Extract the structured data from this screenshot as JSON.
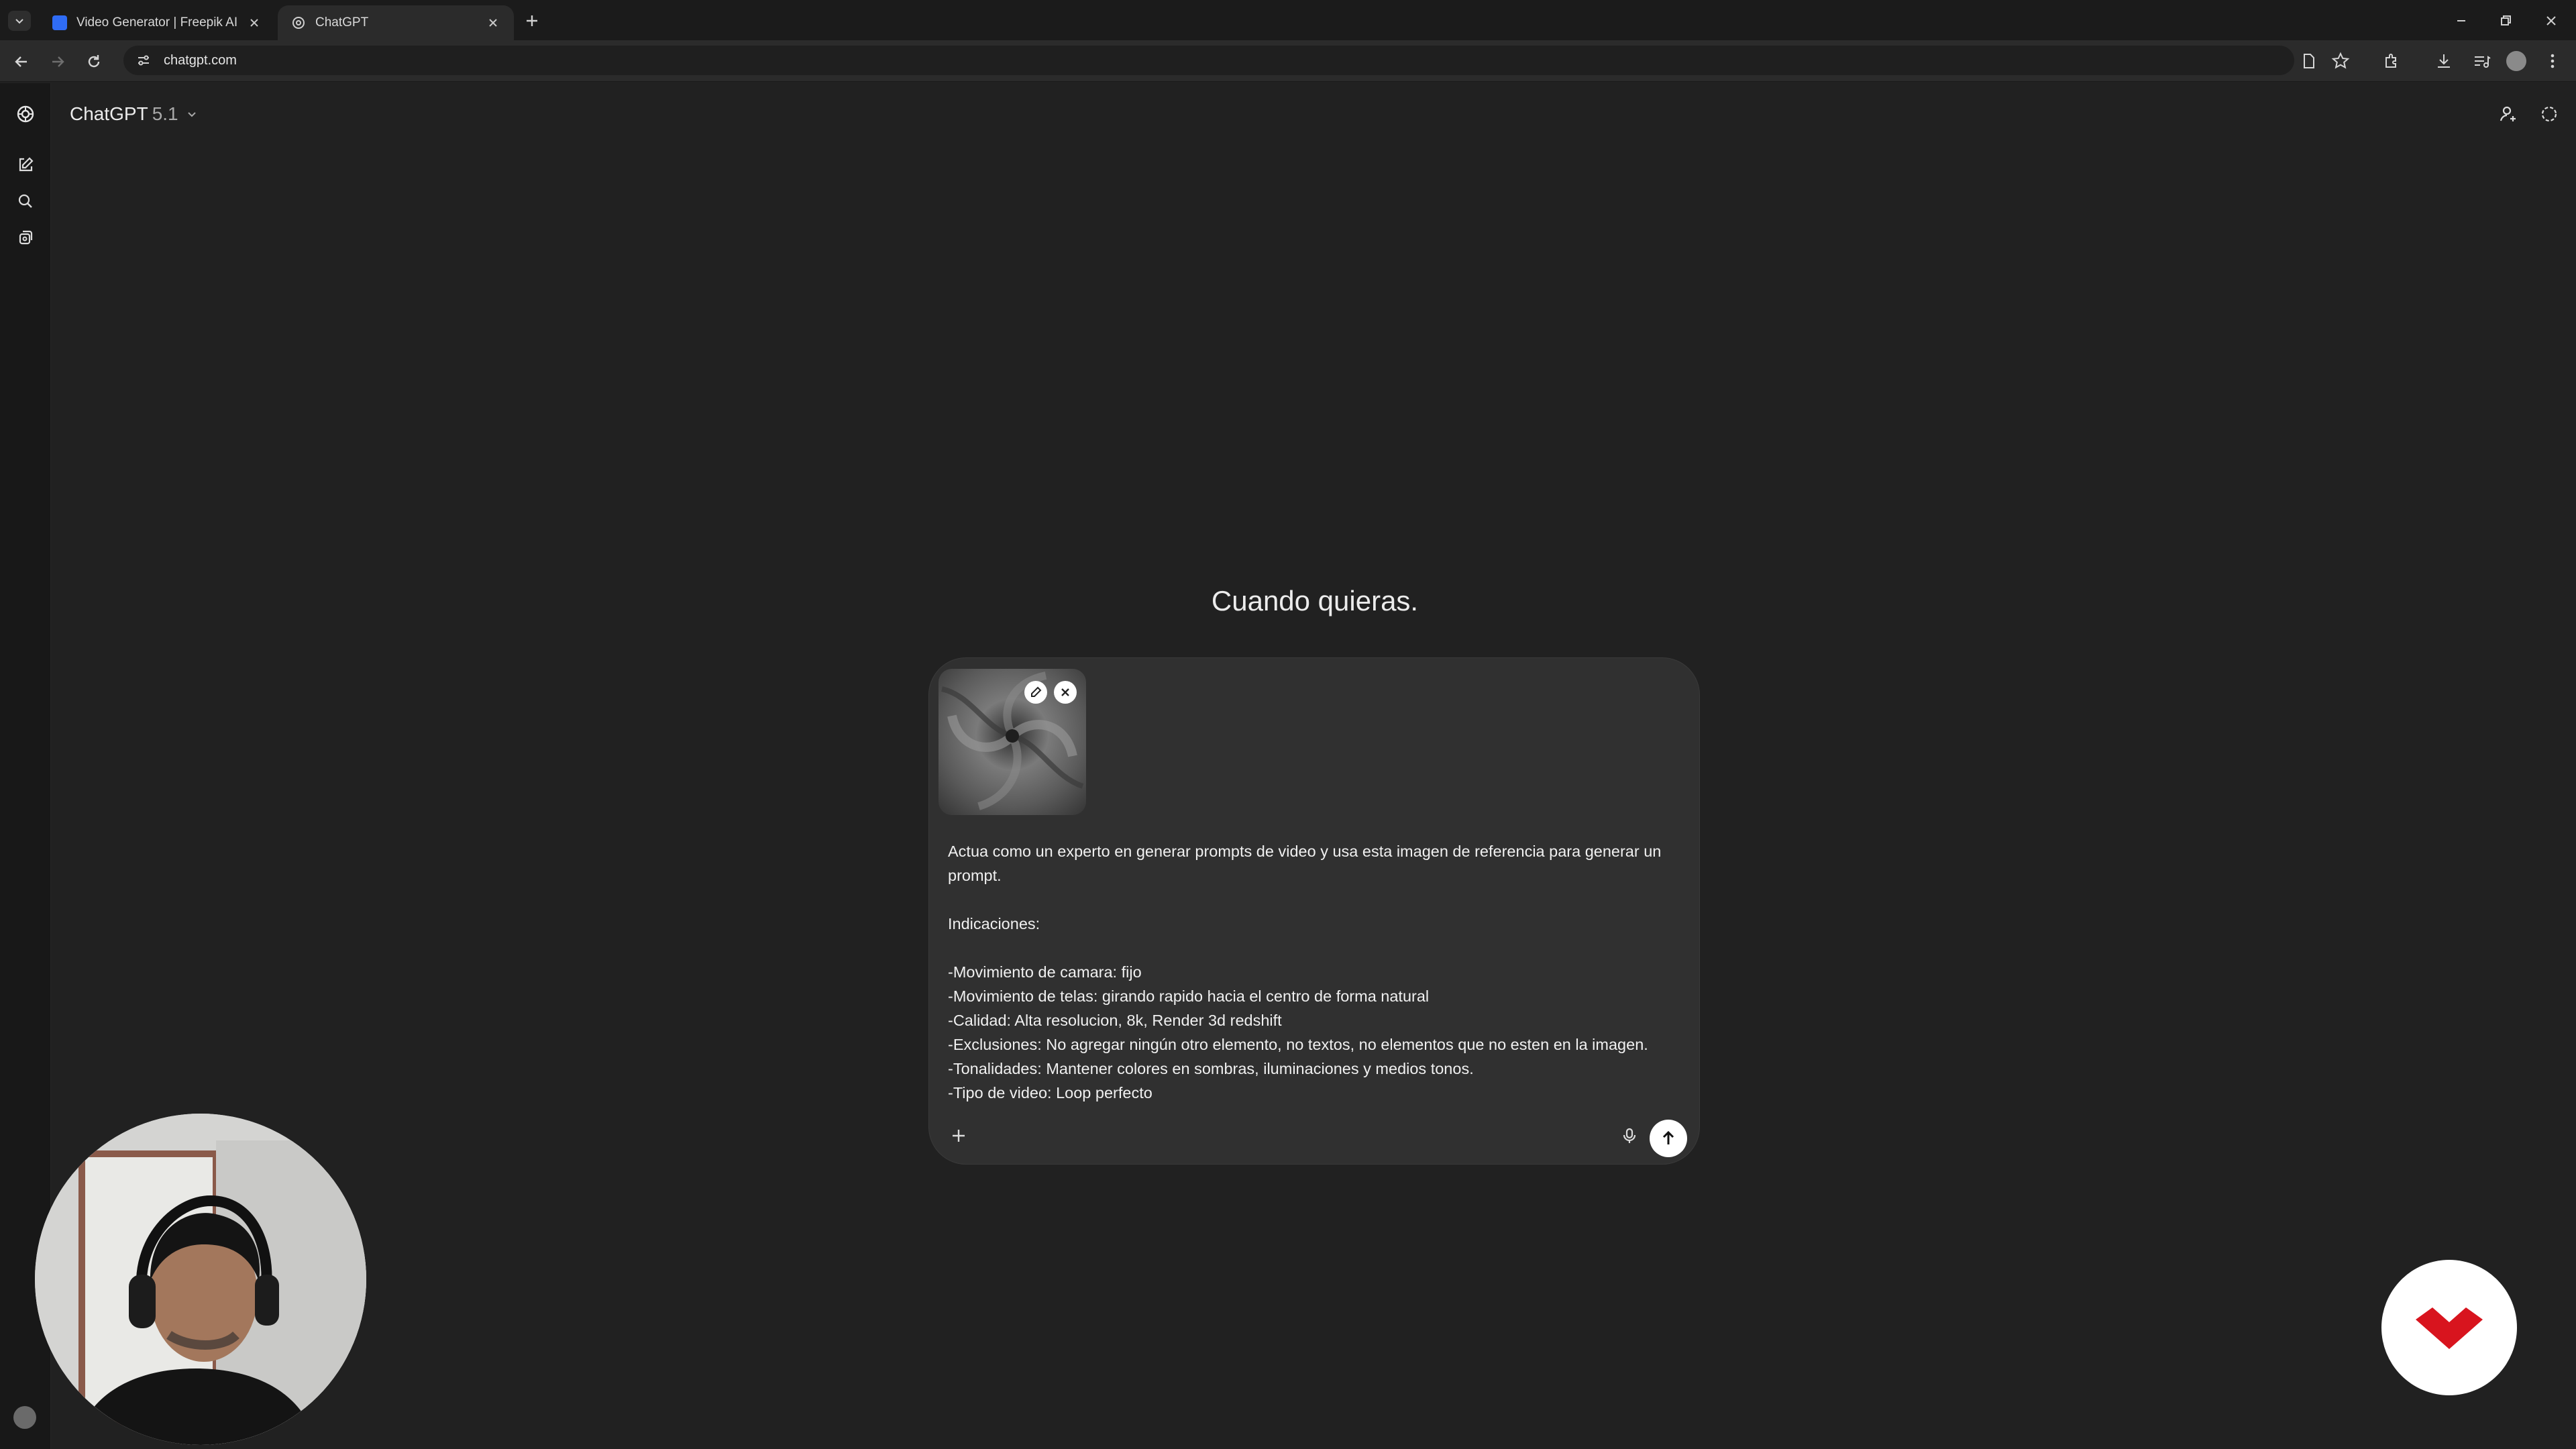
{
  "browser": {
    "tabs": [
      {
        "title": "Video Generator | Freepik AI",
        "active": false
      },
      {
        "title": "ChatGPT",
        "active": true
      }
    ],
    "url": "chatgpt.com"
  },
  "app": {
    "model_name": "ChatGPT",
    "model_version": "5.1",
    "headline": "Cuando quieras."
  },
  "composer": {
    "prompt": "Actua como un experto en generar prompts de video y usa esta imagen de referencia para generar un prompt.\n\nIndicaciones:\n\n-Movimiento de camara: fijo\n-Movimiento de telas: girando rapido hacia el centro de forma natural\n-Calidad: Alta resolucion, 8k, Render 3d redshift\n-Exclusiones: No agregar ningún otro elemento, no textos, no elementos que no esten en la imagen.\n-Tonalidades: Mantener colores en sombras, iluminaciones y medios tonos.\n-Tipo de video: Loop perfecto"
  },
  "icons": {
    "app_logo": "openai-logo-icon",
    "new_chat": "edit-icon",
    "search": "search-icon",
    "library": "library-icon",
    "mic": "mic-icon",
    "send": "arrow-up-icon"
  },
  "colors": {
    "background": "#212121",
    "composer": "#303030",
    "sidebar": "#181818",
    "brand_red": "#d8141e"
  }
}
